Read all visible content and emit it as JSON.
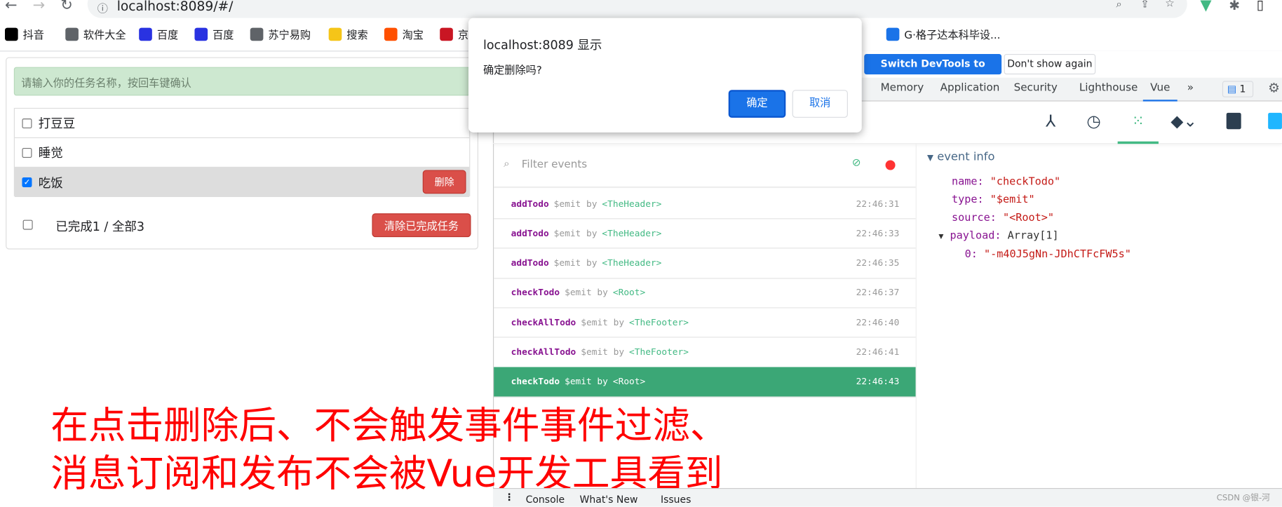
{
  "browser": {
    "url": "localhost:8089/#/",
    "bookmarks": [
      {
        "label": "抖音",
        "color": "#000000"
      },
      {
        "label": "软件大全",
        "color": "#5f6368"
      },
      {
        "label": "百度",
        "color": "#2932e1"
      },
      {
        "label": "百度",
        "color": "#2932e1"
      },
      {
        "label": "苏宁易购",
        "color": "#5f6368"
      },
      {
        "label": "搜索",
        "color": "#f5c518"
      },
      {
        "label": "淘宝",
        "color": "#ff5000"
      },
      {
        "label": "京",
        "color": "#c91623"
      },
      {
        "label": "...",
        "color": ""
      },
      {
        "label": "G·格子达本科毕设...",
        "color": "#1a73e8"
      }
    ]
  },
  "app": {
    "input_placeholder": "请输入你的任务名称，按回车键确认",
    "todos": [
      {
        "title": "打豆豆",
        "done": false
      },
      {
        "title": "睡觉",
        "done": false
      },
      {
        "title": "吃饭",
        "done": true
      }
    ],
    "delete_label": "删除",
    "footer_text": "已完成1 / 全部3",
    "clear_label": "清除已完成任务"
  },
  "dialog": {
    "title": "localhost:8089 显示",
    "message": "确定删除吗?",
    "ok": "确定",
    "cancel": "取消"
  },
  "devtools": {
    "switch_label": "Switch DevTools to Chinese",
    "dont_show": "Don't show again",
    "tabs": [
      "Memory",
      "Application",
      "Security",
      "Lighthouse",
      "Vue",
      "»"
    ],
    "active_tab": "Vue",
    "issues_badge": "1",
    "filter_placeholder": "Filter events",
    "events": [
      {
        "name": "addTodo",
        "by": "$emit by",
        "comp": "<TheHeader>",
        "time": "22:46:31"
      },
      {
        "name": "addTodo",
        "by": "$emit by",
        "comp": "<TheHeader>",
        "time": "22:46:33"
      },
      {
        "name": "addTodo",
        "by": "$emit by",
        "comp": "<TheHeader>",
        "time": "22:46:35"
      },
      {
        "name": "checkTodo",
        "by": "$emit by",
        "comp": "<Root>",
        "time": "22:46:37"
      },
      {
        "name": "checkAllTodo",
        "by": "$emit by",
        "comp": "<TheFooter>",
        "time": "22:46:40"
      },
      {
        "name": "checkAllTodo",
        "by": "$emit by",
        "comp": "<TheFooter>",
        "time": "22:46:41"
      },
      {
        "name": "checkTodo",
        "by": "$emit by",
        "comp": "<Root>",
        "time": "22:46:43",
        "selected": true
      }
    ],
    "info": {
      "header": "event info",
      "name_key": "name:",
      "name_val": "\"checkTodo\"",
      "type_key": "type:",
      "type_val": "\"$emit\"",
      "source_key": "source:",
      "source_val": "\"<Root>\"",
      "payload_key": "payload:",
      "payload_val": "Array[1]",
      "item_key": "0:",
      "item_val": "\"-m40J5gNn-JDhCTFcFW5s\""
    },
    "drawer": [
      "Console",
      "What's New",
      "Issues"
    ]
  },
  "annotation": [
    "在点击删除后、不会触发事件事件过滤、",
    "消息订阅和发布不会被Vue开发工具看到"
  ],
  "watermark": "CSDN @银-河"
}
